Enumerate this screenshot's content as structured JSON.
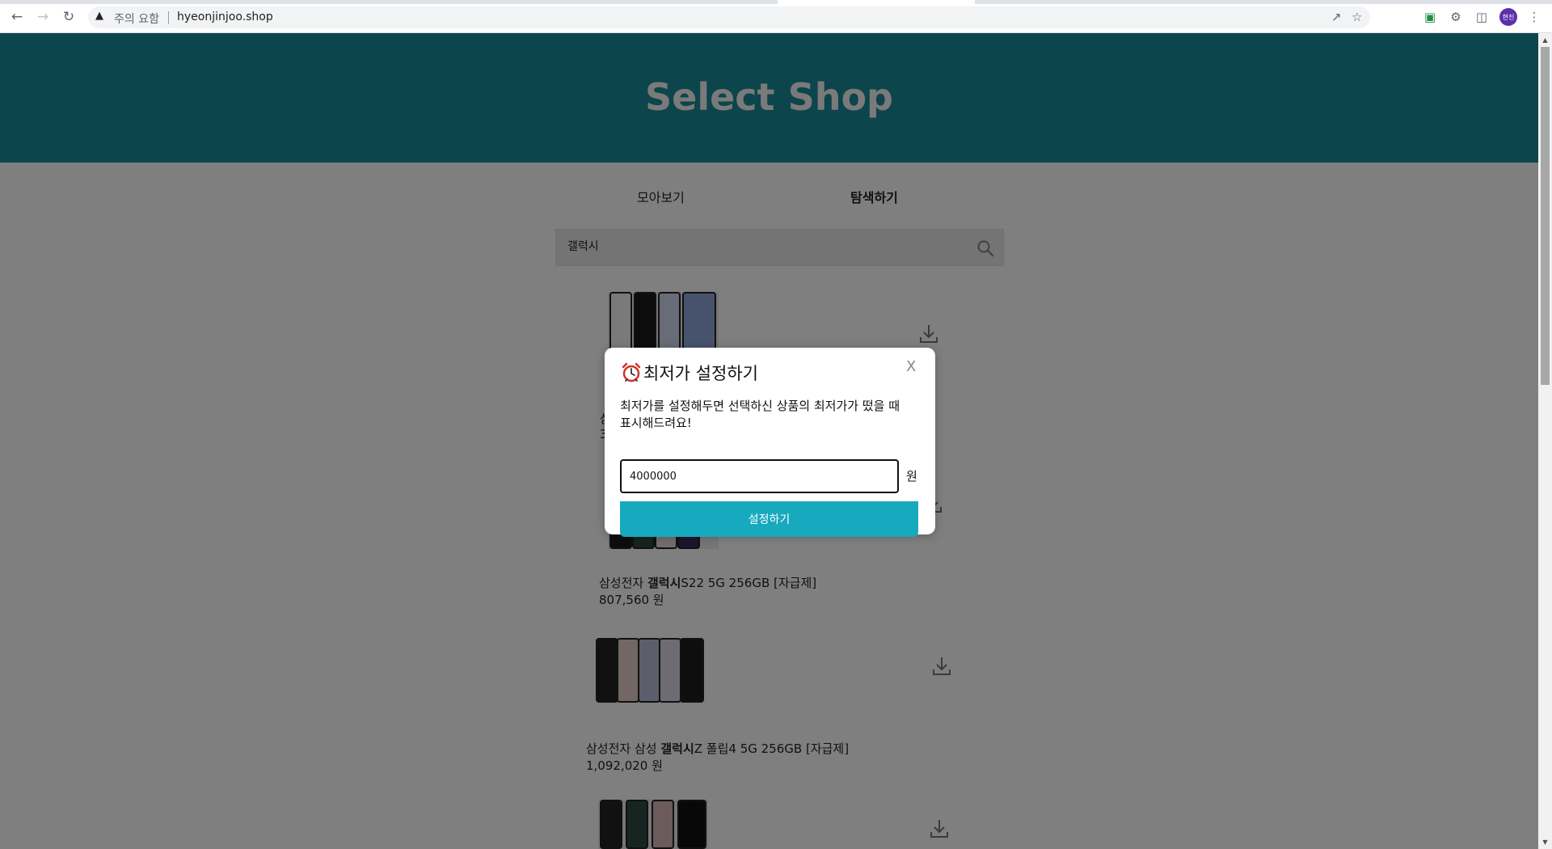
{
  "browser": {
    "security_label": "주의 요함",
    "url": "hyeonjinjoo.shop",
    "avatar_text": "현진"
  },
  "header": {
    "title": "Select Shop"
  },
  "tabs": [
    {
      "label": "모아보기",
      "active": false
    },
    {
      "label": "탐색하기",
      "active": true
    }
  ],
  "search": {
    "value": "갤럭시"
  },
  "products": [
    {
      "prefix": "삼성전자 ",
      "highlight": "갤럭시",
      "suffix": "S22 5G 256GB [자급제]",
      "price": "807,560 원"
    },
    {
      "prefix": "삼성전자 삼성 ",
      "highlight": "갤럭시",
      "suffix": "Z 폴립4 5G 256GB [자급제]",
      "price": "1,092,020 원"
    }
  ],
  "hidden_product": {
    "name_start": "삼",
    "price_start": "3"
  },
  "modal": {
    "icon": "alarm-clock-icon",
    "title": "최저가 설정하기",
    "close_label": "X",
    "description_line1": "최저가를 설정해두면 선택하신 상품의 최저가가 떴을 때",
    "description_line2": "표시해드려요!",
    "input_value": "4000000",
    "unit": "원",
    "submit_label": "설정하기"
  },
  "colors": {
    "header_bg": "#1b8a99",
    "button_bg": "#17a9bd",
    "overlay": "rgba(0,0,0,0.5)"
  }
}
